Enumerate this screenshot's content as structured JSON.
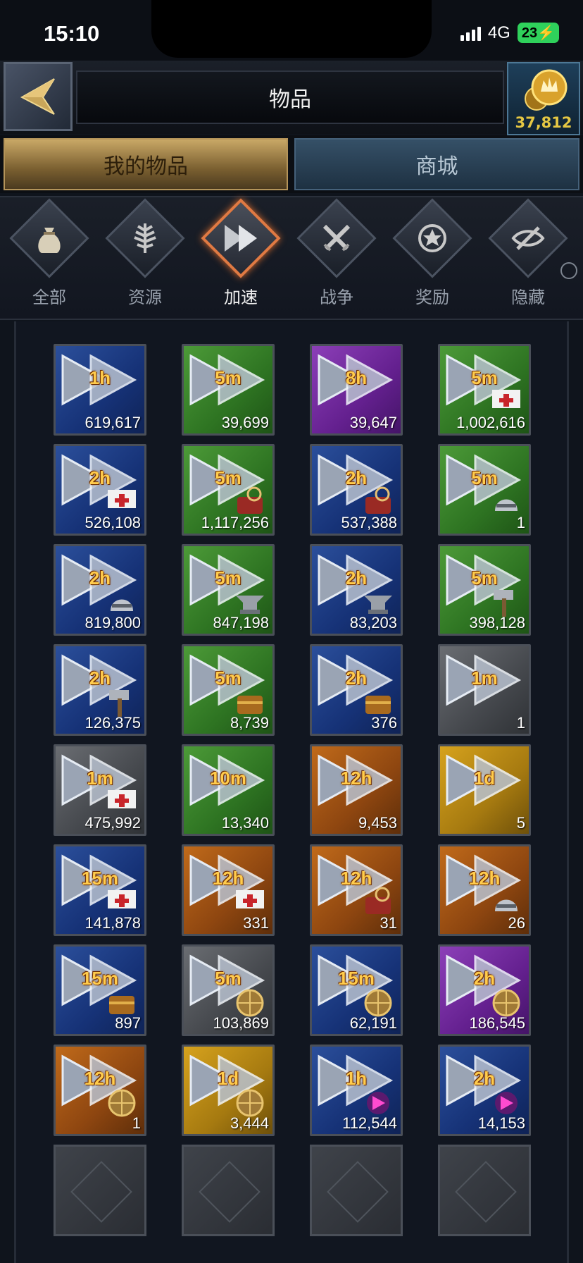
{
  "status_bar": {
    "time": "15:10",
    "network": "4G",
    "battery": "23"
  },
  "header": {
    "title": "物品",
    "coins": "37,812"
  },
  "tabs": [
    {
      "label": "我的物品",
      "active": true
    },
    {
      "label": "商城",
      "active": false
    }
  ],
  "categories": [
    {
      "label": "全部",
      "icon": "bag-icon",
      "active": false
    },
    {
      "label": "资源",
      "icon": "leaf-icon",
      "active": false
    },
    {
      "label": "加速",
      "icon": "speedup-icon",
      "active": true
    },
    {
      "label": "战争",
      "icon": "crossed-swords-icon",
      "active": false
    },
    {
      "label": "奖励",
      "icon": "star-badge-icon",
      "active": false
    },
    {
      "label": "隐藏",
      "icon": "hidden-eye-icon",
      "active": false
    }
  ],
  "colors": {
    "blue": "#1c3a85",
    "green": "#34802a",
    "purple": "#6c2598",
    "gray": "#505358",
    "orange": "#9a4e12",
    "yellow": "#b58612",
    "duration_text": "#ffcc4d",
    "coin_text": "#e5c743",
    "active_category": "#e07a43"
  },
  "items": [
    {
      "dur": "1h",
      "qty": "619,617",
      "color": "blue",
      "badge": ""
    },
    {
      "dur": "5m",
      "qty": "39,699",
      "color": "green",
      "badge": ""
    },
    {
      "dur": "8h",
      "qty": "39,647",
      "color": "purple",
      "badge": ""
    },
    {
      "dur": "5m",
      "qty": "1,002,616",
      "color": "green",
      "badge": "healing-flag-icon"
    },
    {
      "dur": "2h",
      "qty": "526,108",
      "color": "blue",
      "badge": "healing-flag-icon"
    },
    {
      "dur": "5m",
      "qty": "1,117,256",
      "color": "green",
      "badge": "research-icon"
    },
    {
      "dur": "2h",
      "qty": "537,388",
      "color": "blue",
      "badge": "research-icon"
    },
    {
      "dur": "5m",
      "qty": "1",
      "color": "green",
      "badge": "helmet-icon"
    },
    {
      "dur": "2h",
      "qty": "819,800",
      "color": "blue",
      "badge": "helmet-icon"
    },
    {
      "dur": "5m",
      "qty": "847,198",
      "color": "green",
      "badge": "anvil-icon"
    },
    {
      "dur": "2h",
      "qty": "83,203",
      "color": "blue",
      "badge": "anvil-icon"
    },
    {
      "dur": "5m",
      "qty": "398,128",
      "color": "green",
      "badge": "hammer-icon"
    },
    {
      "dur": "2h",
      "qty": "126,375",
      "color": "blue",
      "badge": "hammer-icon"
    },
    {
      "dur": "5m",
      "qty": "8,739",
      "color": "green",
      "badge": "chest-icon"
    },
    {
      "dur": "2h",
      "qty": "376",
      "color": "blue",
      "badge": "chest-icon"
    },
    {
      "dur": "1m",
      "qty": "1",
      "color": "gray",
      "badge": ""
    },
    {
      "dur": "1m",
      "qty": "475,992",
      "color": "gray",
      "badge": "healing-flag-icon"
    },
    {
      "dur": "10m",
      "qty": "13,340",
      "color": "green",
      "badge": ""
    },
    {
      "dur": "12h",
      "qty": "9,453",
      "color": "orange",
      "badge": ""
    },
    {
      "dur": "1d",
      "qty": "5",
      "color": "yellow",
      "badge": ""
    },
    {
      "dur": "15m",
      "qty": "141,878",
      "color": "blue",
      "badge": "healing-flag-icon"
    },
    {
      "dur": "12h",
      "qty": "331",
      "color": "orange",
      "badge": "healing-flag-icon"
    },
    {
      "dur": "12h",
      "qty": "31",
      "color": "orange",
      "badge": "research-icon"
    },
    {
      "dur": "12h",
      "qty": "26",
      "color": "orange",
      "badge": "helmet-icon"
    },
    {
      "dur": "15m",
      "qty": "897",
      "color": "blue",
      "badge": "chest-icon"
    },
    {
      "dur": "5m",
      "qty": "103,869",
      "color": "gray",
      "badge": "globe-icon"
    },
    {
      "dur": "15m",
      "qty": "62,191",
      "color": "blue",
      "badge": "globe-icon"
    },
    {
      "dur": "2h",
      "qty": "186,545",
      "color": "purple",
      "badge": "globe-icon"
    },
    {
      "dur": "12h",
      "qty": "1",
      "color": "orange",
      "badge": "globe-icon"
    },
    {
      "dur": "1d",
      "qty": "3,444",
      "color": "yellow",
      "badge": "globe-icon"
    },
    {
      "dur": "1h",
      "qty": "112,544",
      "color": "blue",
      "badge": "magic-arrow-icon"
    },
    {
      "dur": "2h",
      "qty": "14,153",
      "color": "blue",
      "badge": "magic-arrow-icon"
    }
  ],
  "empty_slots": 4
}
